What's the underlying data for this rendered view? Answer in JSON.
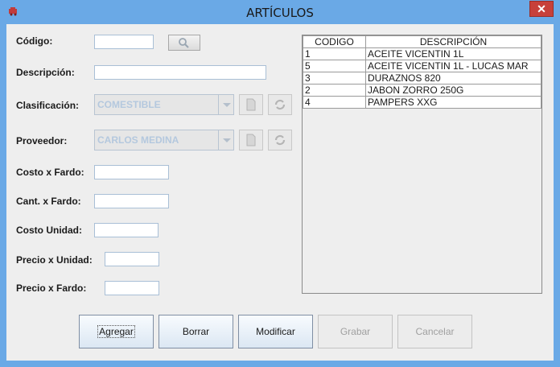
{
  "window": {
    "title": "ARTÍCULOS",
    "close_label": "✕",
    "app_icon": "app-icon"
  },
  "form": {
    "codigo": {
      "label": "Código:",
      "value": ""
    },
    "search_button_icon": "magnifier-icon",
    "descripcion": {
      "label": "Descripción:",
      "value": ""
    },
    "clasificacion": {
      "label": "Clasificación:",
      "selected": "COMESTIBLE"
    },
    "proveedor": {
      "label": "Proveedor:",
      "selected": "CARLOS MEDINA"
    },
    "costo_fardo": {
      "label": "Costo x Fardo:",
      "value": ""
    },
    "cant_fardo": {
      "label": "Cant. x Fardo:",
      "value": ""
    },
    "costo_unidad": {
      "label": "Costo Unidad:",
      "value": ""
    },
    "precio_unidad": {
      "label": "Precio x Unidad:",
      "value": ""
    },
    "precio_fardo": {
      "label": "Precio x Fardo:",
      "value": ""
    }
  },
  "table": {
    "headers": [
      "CODIGO",
      "DESCRIPCIÓN"
    ],
    "rows": [
      [
        "1",
        "ACEITE VICENTIN 1L"
      ],
      [
        "5",
        "ACEITE VICENTIN 1L - LUCAS MAR"
      ],
      [
        "3",
        "DURAZNOS 820"
      ],
      [
        "2",
        "JABON ZORRO 250G"
      ],
      [
        "4",
        "PAMPERS XXG"
      ]
    ]
  },
  "buttons": {
    "agregar": "Agregar",
    "borrar": "Borrar",
    "modificar": "Modificar",
    "grabar": "Grabar",
    "cancelar": "Cancelar"
  },
  "colors": {
    "titlebar": "#6aa9e6",
    "close": "#c7403a",
    "panel": "#eeeeee"
  }
}
